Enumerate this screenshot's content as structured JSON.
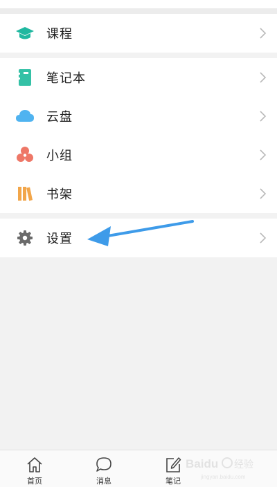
{
  "colors": {
    "course_icon": "#1fb8a0",
    "notebook_icon": "#34c1a6",
    "cloud_icon": "#4fb3f0",
    "group_icon": "#ee7767",
    "bookshelf_icon": "#f2a64a",
    "settings_icon": "#6b6b6b",
    "arrow": "#3e9be9",
    "chevron": "#b9b9b9"
  },
  "menu": {
    "section1": [
      {
        "label": "课程",
        "icon": "graduation-cap-icon"
      }
    ],
    "section2": [
      {
        "label": "笔记本",
        "icon": "notebook-icon"
      },
      {
        "label": "云盘",
        "icon": "cloud-icon"
      },
      {
        "label": "小组",
        "icon": "group-icon"
      },
      {
        "label": "书架",
        "icon": "bookshelf-icon"
      }
    ],
    "section3": [
      {
        "label": "设置",
        "icon": "gear-icon"
      }
    ]
  },
  "tabbar": {
    "home": "首页",
    "messages": "消息",
    "notes": "笔记"
  },
  "watermark": {
    "brand": "Baidu",
    "cn": "经验",
    "url": "jingyan.baidu.com"
  }
}
